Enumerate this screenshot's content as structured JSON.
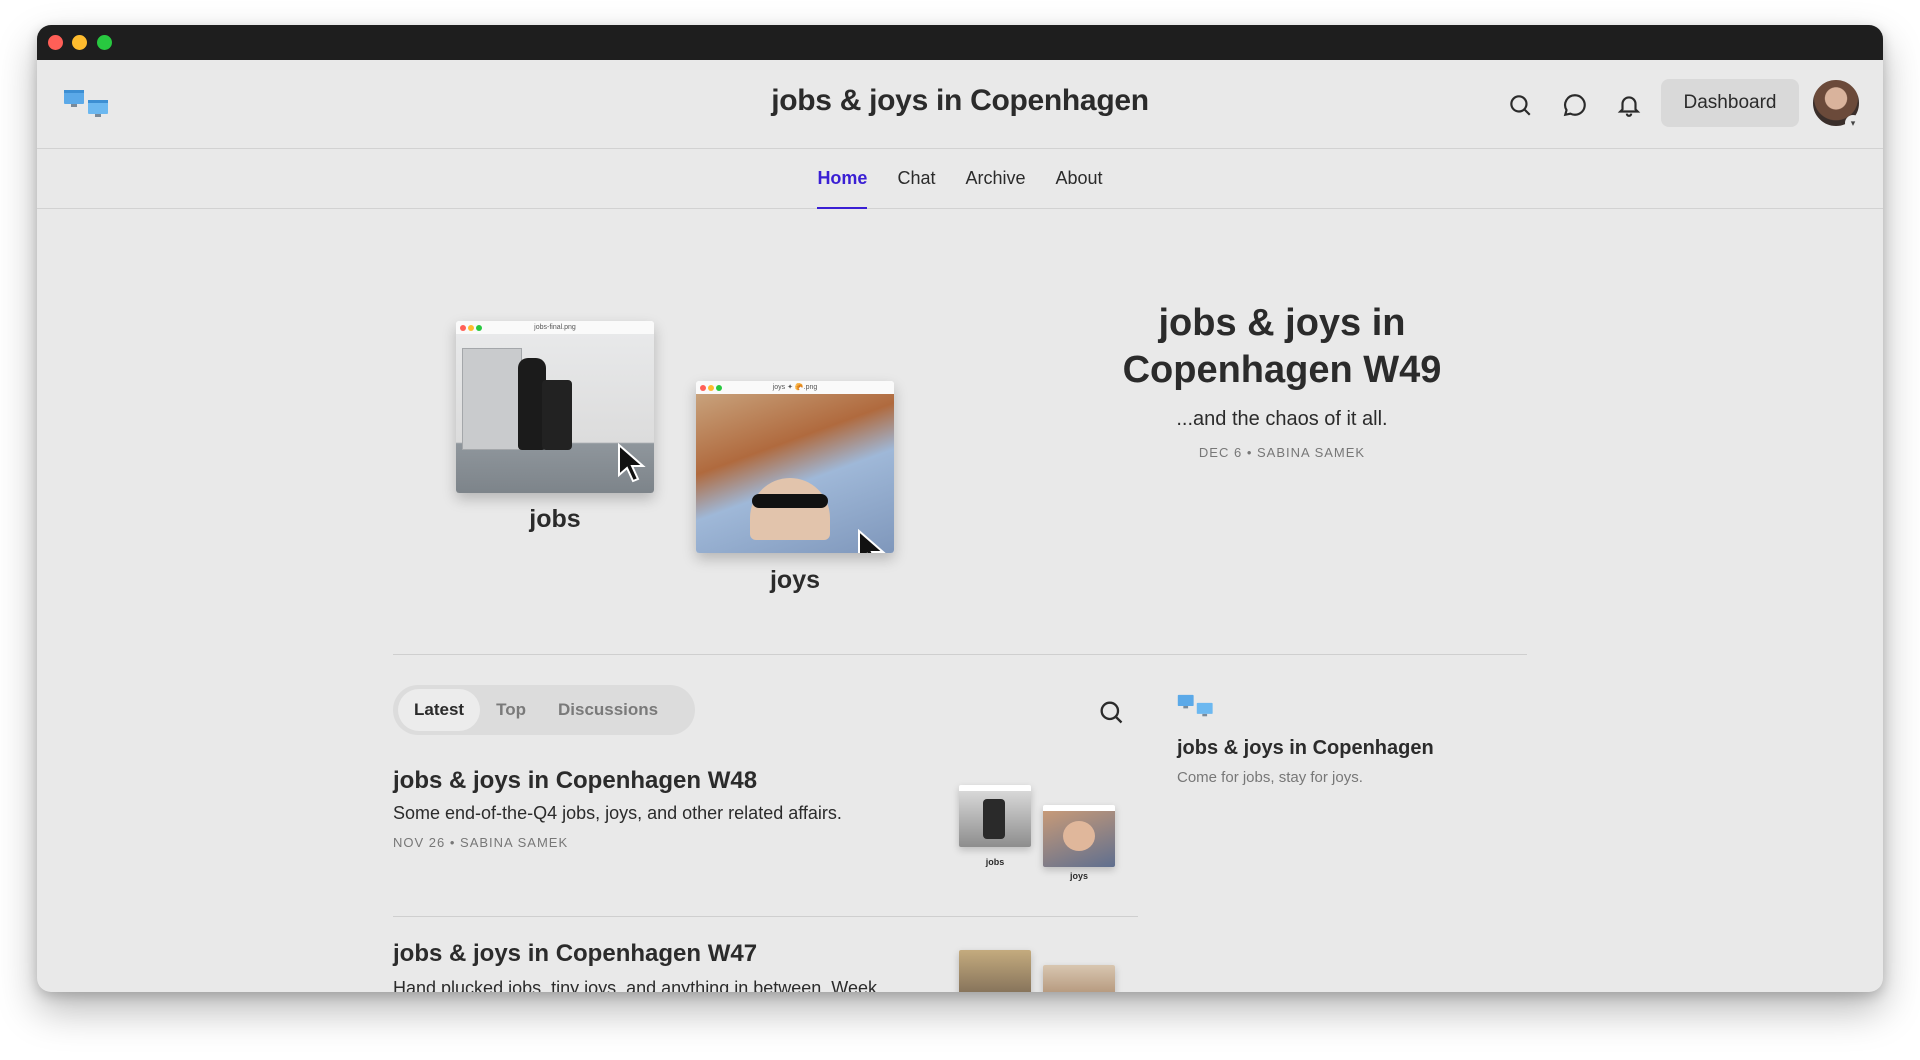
{
  "site": {
    "title": "jobs & joys in Copenhagen"
  },
  "header": {
    "dashboard_label": "Dashboard"
  },
  "nav": {
    "tabs": [
      {
        "label": "Home"
      },
      {
        "label": "Chat"
      },
      {
        "label": "Archive"
      },
      {
        "label": "About"
      }
    ],
    "active": "Home"
  },
  "hero": {
    "title": "jobs & joys in Copenhagen W49",
    "subtitle": "...and the chaos of it all.",
    "meta": "DEC 6 • SABINA SAMEK",
    "image1": {
      "window_title": "jobs-final.png",
      "label": "jobs"
    },
    "image2": {
      "window_title": "joys ✦ 🥐.png",
      "label": "joys"
    }
  },
  "posts_tabs": [
    {
      "label": "Latest"
    },
    {
      "label": "Top"
    },
    {
      "label": "Discussions"
    }
  ],
  "posts": [
    {
      "title": "jobs & joys in Copenhagen W48",
      "subtitle": "Some end-of-the-Q4 jobs, joys, and other related affairs.",
      "meta": "NOV 26 • SABINA SAMEK",
      "thumb_labels": [
        "jobs",
        "joys"
      ]
    },
    {
      "title": "jobs & joys in Copenhagen W47",
      "subtitle": "Hand plucked jobs, tiny joys, and anything in between. Week",
      "meta": ""
    }
  ],
  "sidebar": {
    "title": "jobs & joys in Copenhagen",
    "subtitle": "Come for jobs, stay for joys."
  },
  "colors": {
    "accent": "#3a1fd4",
    "background": "#e9e9e9"
  }
}
